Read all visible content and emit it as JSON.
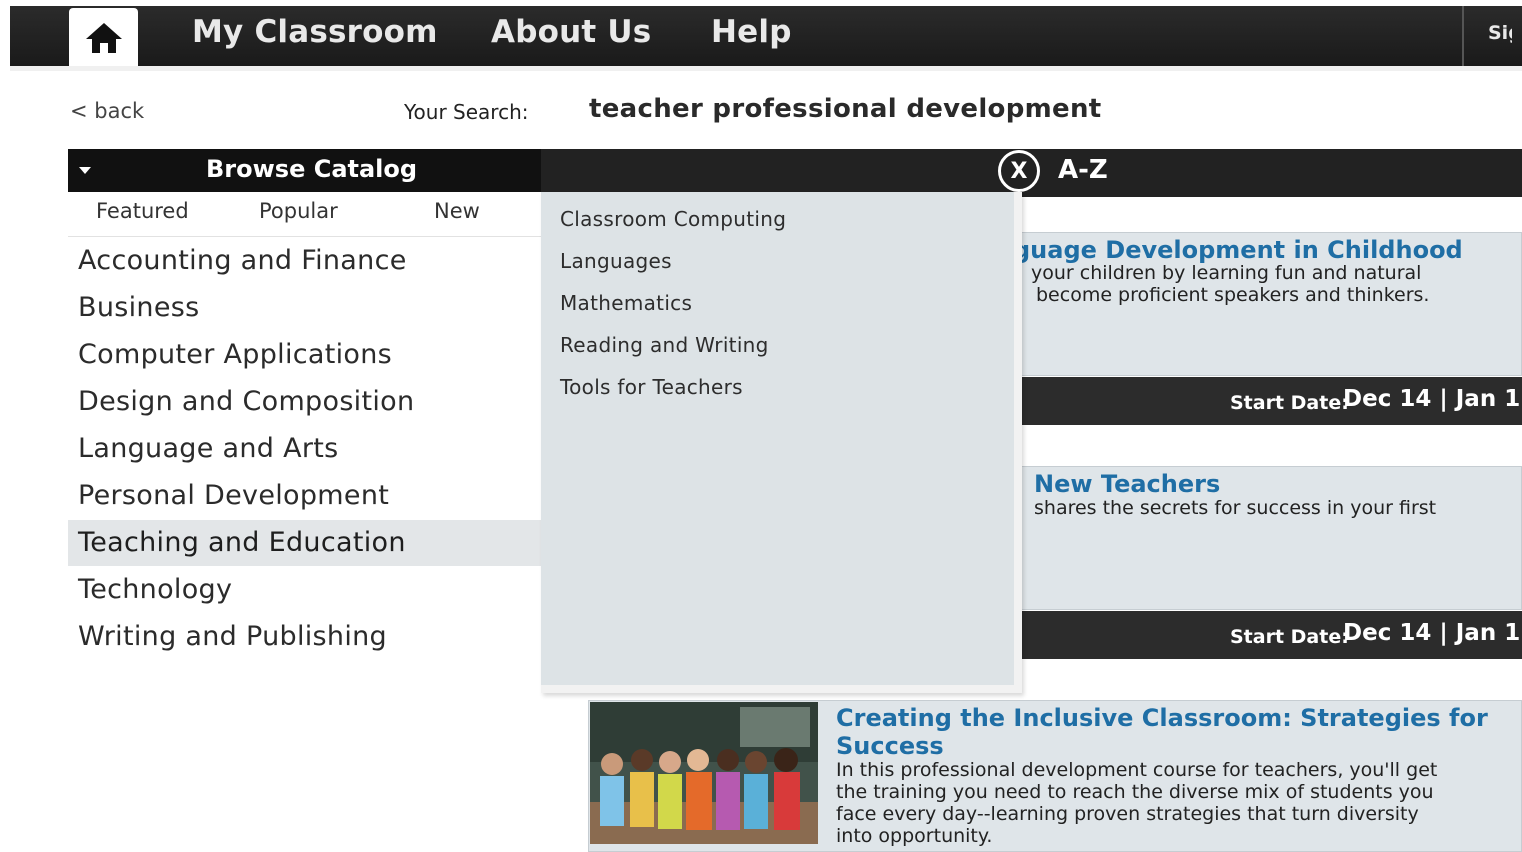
{
  "nav": {
    "home_icon": "home-icon",
    "links": [
      "My Classroom",
      "About Us",
      "Help"
    ],
    "signin_partial": "Sign"
  },
  "search": {
    "back": "< back",
    "label": "Your Search:",
    "query": "teacher professional development"
  },
  "catalog": {
    "title": "Browse Catalog",
    "az": "A-Z",
    "close": "X",
    "subtabs": [
      "Featured",
      "Popular",
      "New"
    ],
    "categories": [
      "Accounting and Finance",
      "Business",
      "Computer Applications",
      "Design and Composition",
      "Language and Arts",
      "Personal Development",
      "Teaching and Education",
      "Technology",
      "Writing and Publishing"
    ],
    "active_category": "Teaching and Education",
    "subcategories": [
      "Classroom Computing",
      "Languages",
      "Mathematics",
      "Reading and Writing",
      "Tools for Teachers"
    ]
  },
  "courses": [
    {
      "title_visible": "guage Development in Childhood",
      "desc_line1": "your children by learning fun and natural",
      "desc_line2": "become proficient speakers and thinkers.",
      "date_label": "Start Date:",
      "dates": "Dec 14 | Jan 1"
    },
    {
      "title_visible": "New Teachers",
      "desc_line1": "shares the secrets for success in your first",
      "date_label": "Start Date:",
      "dates": "Dec 14 | Jan 1"
    },
    {
      "title": "Creating the Inclusive Classroom: Strategies for Success",
      "title_line1": "Creating the Inclusive Classroom: Strategies for",
      "title_line2": "Success",
      "desc_lines": [
        "In this professional development course for teachers, you'll get",
        "the training you need to reach the diverse mix of students you",
        "face every day--learning proven strategies that turn diversity",
        "into opportunity."
      ]
    }
  ],
  "colors": {
    "topbar": "#1f1f1f",
    "catbar": "#111111",
    "panel": "#dde3e6",
    "link_blue": "#1f6ea5",
    "datebar": "#2c2c2c"
  }
}
